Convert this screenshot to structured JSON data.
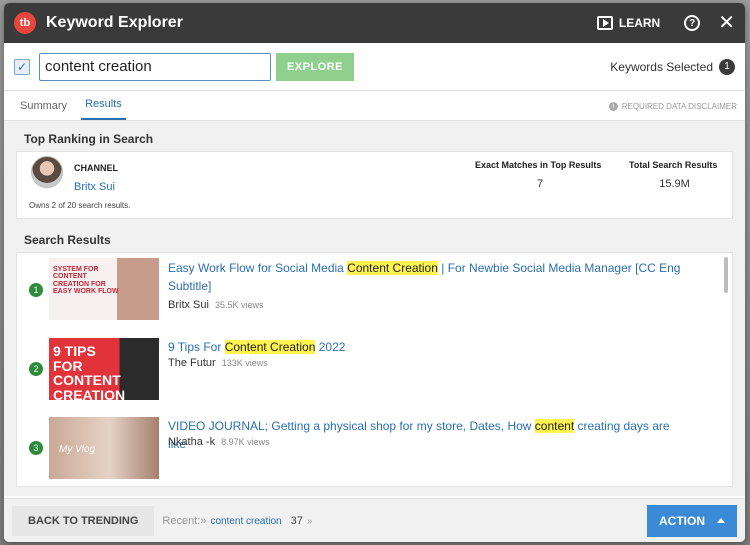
{
  "window": {
    "logo_text": "tb",
    "title": "Keyword Explorer",
    "learn_label": "LEARN",
    "help_glyph": "?",
    "close_glyph": "✕"
  },
  "search": {
    "value": "content creation",
    "explore_label": "EXPLORE",
    "keywords_selected_label": "Keywords Selected",
    "keywords_selected_count": "1"
  },
  "tabs": [
    {
      "label": "Summary",
      "active": false
    },
    {
      "label": "Results",
      "active": true
    }
  ],
  "disclaimer": "REQUIRED DATA DISCLAIMER",
  "top_ranking": {
    "heading": "Top Ranking in Search",
    "channel_label": "CHANNEL",
    "channel_name": "Britx Sui",
    "owns_text": "Owns 2 of 20 search results.",
    "exact_matches_label": "Exact Matches in Top Results",
    "exact_matches_value": "7",
    "total_results_label": "Total Search Results",
    "total_results_value": "15.9M"
  },
  "search_results": {
    "heading": "Search Results",
    "items": [
      {
        "rank": "1",
        "thumb_text": "SYSTEM FOR CONTENT CREATION FOR EASY WORK FLOW",
        "title_before": "Easy Work Flow for Social Media ",
        "title_highlight": "Content Creation",
        "title_after": " | For Newbie Social Media Manager [CC Eng Subtitle]",
        "channel": "Britx Sui",
        "views": "35.5K views"
      },
      {
        "rank": "2",
        "thumb_text": "9 TIPS FOR CONTENT CREATION",
        "title_before": "9 Tips For ",
        "title_highlight": "Content Creation",
        "title_after": " 2022",
        "channel": "The Futur",
        "views": "133K views"
      },
      {
        "rank": "3",
        "thumb_text": "My Vlog",
        "title_before": "VIDEO JOURNAL; Getting a physical shop for my store, Dates, How ",
        "title_highlight": "content",
        "title_after": " creating days are like",
        "channel": "Nkatha -k",
        "views": "8.97K views"
      }
    ]
  },
  "footer": {
    "back_label": "BACK TO TRENDING",
    "recent_label": "Recent:»",
    "recent_link": "content creation",
    "recent_count": "37",
    "recent_arrow": "»",
    "action_label": "ACTION"
  },
  "colors": {
    "titlebar": "#3a3a3a",
    "accent_blue": "#2a6fb0",
    "explore_green": "#8fd08f",
    "rank_green": "#2e8b3a",
    "highlight": "#fff34f",
    "action_blue": "#3a8ad6"
  }
}
